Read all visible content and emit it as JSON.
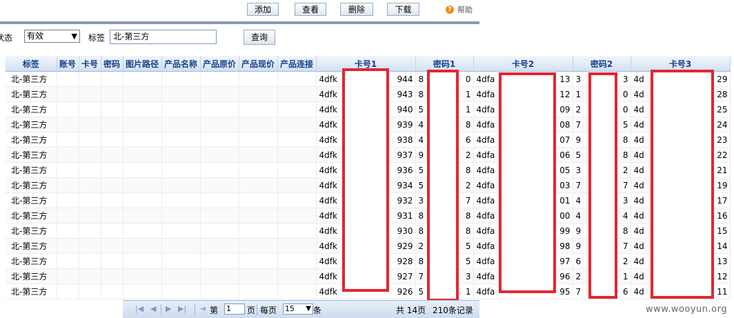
{
  "toolbar": {
    "add_label": "添加",
    "view_label": "查看",
    "delete_label": "删除",
    "download_label": "下载",
    "help_label": "帮助"
  },
  "filter": {
    "status_label": "状态",
    "status_value": "有效",
    "tag_label": "标签",
    "tag_value": "北-第三方",
    "query_label": "查询"
  },
  "table": {
    "headers": [
      "标签",
      "账号",
      "卡号",
      "密码",
      "图片路径",
      "产品名称",
      "产品原价",
      "产品现价",
      "产品连接",
      "卡号1",
      "密码1",
      "卡号2",
      "密码2",
      "卡号3"
    ],
    "rows": [
      [
        "北-第三方",
        "4dfk",
        "944",
        "8",
        "0",
        "4dfa",
        "13",
        "3",
        "3",
        "4d",
        "29"
      ],
      [
        "北-第三方",
        "4dfk",
        "943",
        "8",
        "1",
        "4dfa",
        "12",
        "1",
        "0",
        "4d",
        "28"
      ],
      [
        "北-第三方",
        "4dfk",
        "940",
        "5",
        "1",
        "4dfa",
        "09",
        "2",
        "0",
        "4d",
        "25"
      ],
      [
        "北-第三方",
        "4dfk",
        "939",
        "4",
        "8",
        "4dfa",
        "08",
        "7",
        "5",
        "4d",
        "24"
      ],
      [
        "北-第三方",
        "4dfk",
        "938",
        "4",
        "6",
        "4dfa",
        "07",
        "9",
        "8",
        "4d",
        "23"
      ],
      [
        "北-第三方",
        "4dfk",
        "937",
        "9",
        "2",
        "4dfa",
        "06",
        "5",
        "8",
        "4d",
        "22"
      ],
      [
        "北-第三方",
        "4dfk",
        "936",
        "5",
        "8",
        "4dfa",
        "05",
        "3",
        "2",
        "4d",
        "21"
      ],
      [
        "北-第三方",
        "4dfk",
        "934",
        "5",
        "2",
        "4dfa",
        "03",
        "7",
        "7",
        "4d",
        "19"
      ],
      [
        "北-第三方",
        "4dfk",
        "932",
        "3",
        "7",
        "4dfa",
        "01",
        "4",
        "3",
        "4d",
        "17"
      ],
      [
        "北-第三方",
        "4dfk",
        "931",
        "8",
        "8",
        "4dfa",
        "00",
        "4",
        "4",
        "4d",
        "16"
      ],
      [
        "北-第三方",
        "4dfk",
        "930",
        "8",
        "8",
        "4dfa",
        "99",
        "9",
        "8",
        "4d",
        "15"
      ],
      [
        "北-第三方",
        "4dfk",
        "929",
        "2",
        "5",
        "4dfa",
        "98",
        "9",
        "7",
        "4d",
        "14"
      ],
      [
        "北-第三方",
        "4dfk",
        "928",
        "8",
        "5",
        "4dfa",
        "97",
        "6",
        "2",
        "4d",
        "13"
      ],
      [
        "北-第三方",
        "4dfk",
        "927",
        "7",
        "3",
        "4dfa",
        "96",
        "2",
        "1",
        "4d",
        "12"
      ],
      [
        "北-第三方",
        "4dfk",
        "926",
        "5",
        "1",
        "4dfa",
        "95",
        "7",
        "6",
        "4d",
        "11"
      ]
    ]
  },
  "pager": {
    "page_prefix": "第",
    "page_value": "1",
    "page_suffix": "页",
    "per_page_label": "每页",
    "per_page_value": "15",
    "per_page_suffix": "条",
    "total_pages": "共 14页",
    "total_records": "210条记录"
  },
  "watermark": "www.wooyun.org",
  "colors": {
    "redaction": "#e3262f",
    "header_text": "#15428b",
    "help_icon": "#f08a1c"
  }
}
